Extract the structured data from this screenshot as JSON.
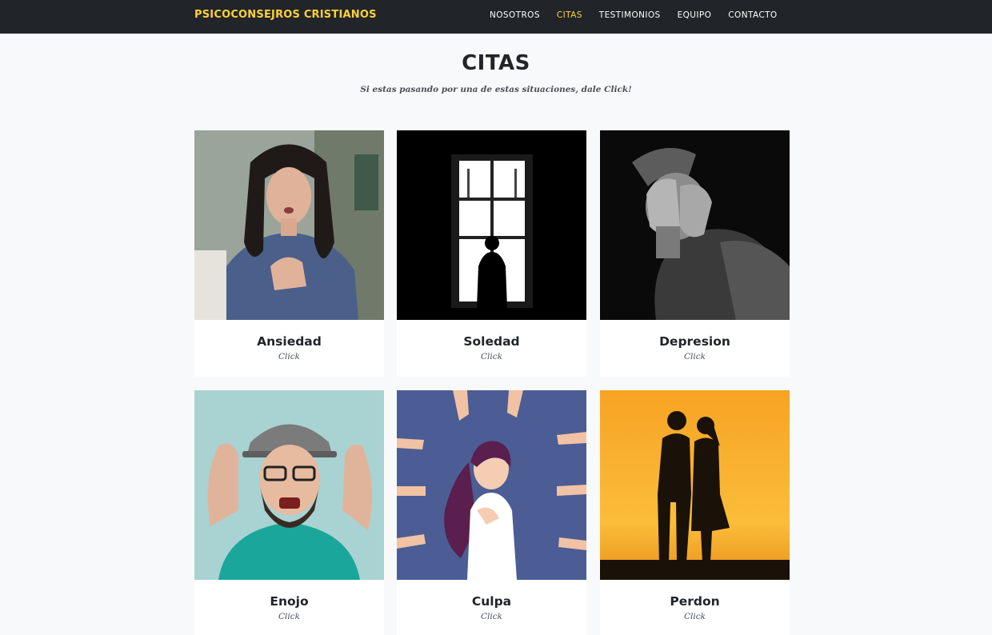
{
  "navbar": {
    "brand": "PSICOCONSEJROS CRISTIANOS",
    "items": [
      {
        "label": "NOSOTROS",
        "active": false
      },
      {
        "label": "CITAS",
        "active": true
      },
      {
        "label": "TESTIMONIOS",
        "active": false
      },
      {
        "label": "EQUIPO",
        "active": false
      },
      {
        "label": "CONTACTO",
        "active": false
      }
    ]
  },
  "section": {
    "heading": "CITAS",
    "subheading": "Si estas pasando por una de estas situaciones, dale Click!"
  },
  "cards": [
    {
      "title": "Ansiedad",
      "subtitle": "Click"
    },
    {
      "title": "Soledad",
      "subtitle": "Click"
    },
    {
      "title": "Depresion",
      "subtitle": "Click"
    },
    {
      "title": "Enojo",
      "subtitle": "Click"
    },
    {
      "title": "Culpa",
      "subtitle": "Click"
    },
    {
      "title": "Perdon",
      "subtitle": "Click"
    }
  ],
  "colors": {
    "navbar_bg": "#212529",
    "accent": "#fed136",
    "page_bg": "#f8f9fa",
    "card_bg": "#ffffff"
  }
}
